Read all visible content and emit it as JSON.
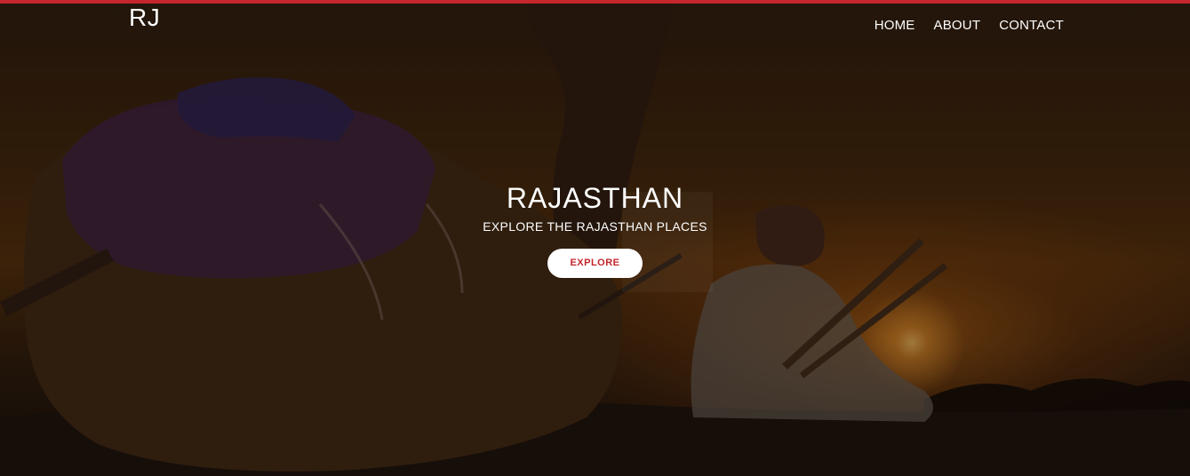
{
  "header": {
    "logo": "RJ",
    "nav": [
      {
        "label": "HOME"
      },
      {
        "label": "ABOUT"
      },
      {
        "label": "CONTACT"
      }
    ]
  },
  "hero": {
    "title": "RAJASTHAN",
    "subtitle": "EXPLORE THE RAJASTHAN PLACES",
    "button_label": "EXPLORE"
  },
  "colors": {
    "accent": "#c4262b",
    "text": "#ffffff"
  }
}
